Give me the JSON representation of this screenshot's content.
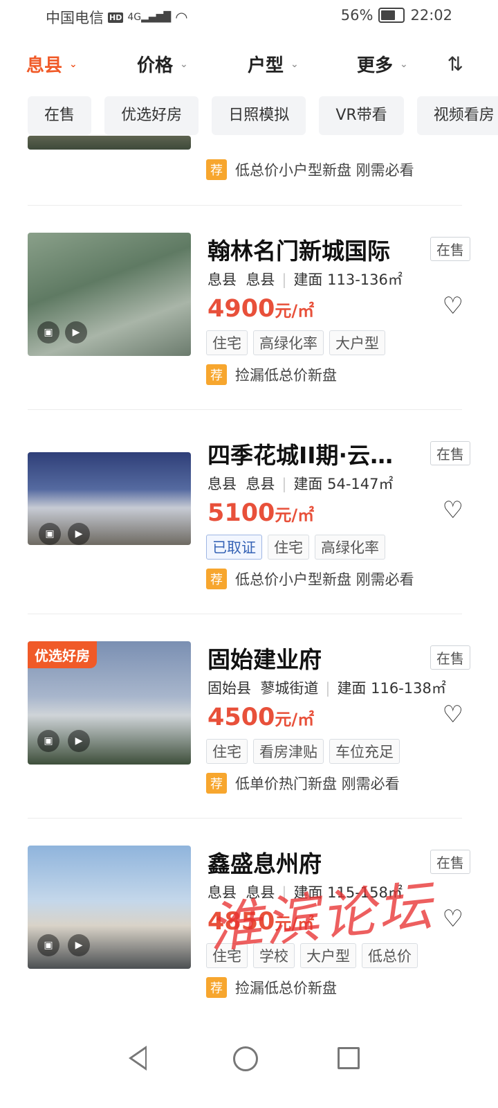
{
  "status_bar": {
    "carrier": "中国电信",
    "hd": "HD",
    "network": "4G",
    "battery": "56%",
    "time": "22:02"
  },
  "filters": [
    {
      "label": "息县",
      "active": true
    },
    {
      "label": "价格",
      "active": false
    },
    {
      "label": "户型",
      "active": false
    },
    {
      "label": "更多",
      "active": false
    }
  ],
  "chips": [
    "在售",
    "优选好房",
    "日照模拟",
    "VR带看",
    "视频看房"
  ],
  "partial_listing": {
    "rec": "低总价小户型新盘 刚需必看"
  },
  "listings": [
    {
      "title": "翰林名门新城国际",
      "status": "在售",
      "county": "息县",
      "area": "息县",
      "size": "建面 113-136㎡",
      "price": "4900",
      "price_unit": "元/㎡",
      "tags": [
        "住宅",
        "高绿化率",
        "大户型"
      ],
      "rec": "捡漏低总价新盘"
    },
    {
      "title": "四季花城II期·云竹…",
      "status": "在售",
      "county": "息县",
      "area": "息县",
      "size": "建面 54-147㎡",
      "price": "5100",
      "price_unit": "元/㎡",
      "tags": [
        "已取证",
        "住宅",
        "高绿化率"
      ],
      "rec": "低总价小户型新盘 刚需必看"
    },
    {
      "title": "固始建业府",
      "status": "在售",
      "badge": "优选好房",
      "county": "固始县",
      "area": "蓼城街道",
      "size": "建面 116-138㎡",
      "price": "4500",
      "price_unit": "元/㎡",
      "tags": [
        "住宅",
        "看房津贴",
        "车位充足"
      ],
      "rec": "低单价热门新盘 刚需必看"
    },
    {
      "title": "鑫盛息州府",
      "status": "在售",
      "county": "息县",
      "area": "息县",
      "size": "建面 115-158㎡",
      "price": "4850",
      "price_unit": "元/㎡",
      "tags": [
        "住宅",
        "学校",
        "大户型",
        "低总价"
      ],
      "rec": "捡漏低总价新盘"
    }
  ],
  "watermark": "淮滨论坛",
  "icons": {
    "heart": "heart-icon",
    "rec": "荐",
    "sort": "sort-icon"
  }
}
